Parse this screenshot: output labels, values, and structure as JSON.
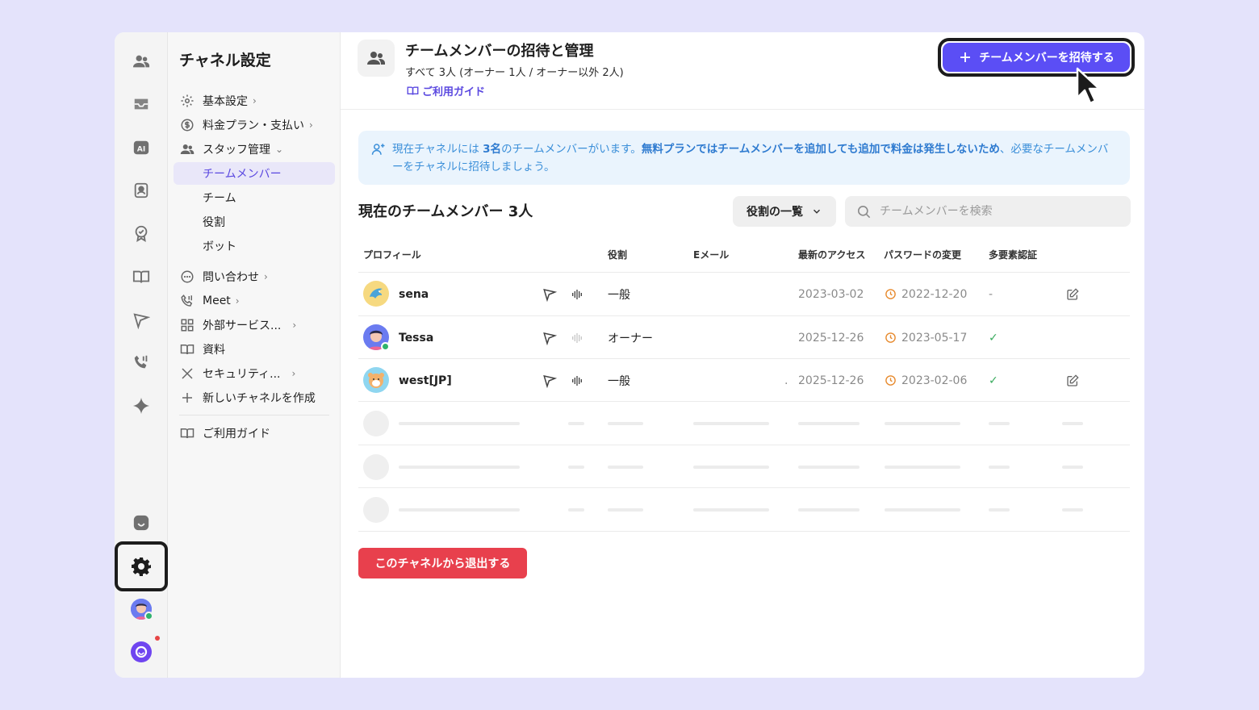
{
  "nav": {
    "title": "チャネル設定",
    "items": [
      {
        "label": "基本設定",
        "chev": "›"
      },
      {
        "label": "料金プラン・支払い",
        "chev": "›"
      },
      {
        "label": "スタッフ管理",
        "chev": "⌄"
      },
      {
        "label": "問い合わせ",
        "chev": "›"
      },
      {
        "label": "Meet",
        "chev": "›"
      },
      {
        "label": "外部サービス...",
        "chev": "›"
      },
      {
        "label": "資料",
        "chev": ""
      },
      {
        "label": "セキュリティ...",
        "chev": "›"
      },
      {
        "label": "新しいチャネルを作成",
        "chev": ""
      }
    ],
    "sub_items": [
      "チームメンバー",
      "チーム",
      "役割",
      "ボット"
    ],
    "guide": "ご利用ガイド"
  },
  "header": {
    "title": "チームメンバーの招待と管理",
    "subtitle": "すべて 3人 (オーナー 1人 / オーナー以外 2人)",
    "guide": "ご利用ガイド",
    "invite_button": "チームメンバーを招待する"
  },
  "info": {
    "part1": "現在チャネルには ",
    "bold1": "3名",
    "part2": "のチームメンバーがいます。",
    "bold2": "無料プランではチームメンバーを追加しても追加で料金は発生しないため",
    "part3": "、必要なチームメンバーをチャネルに招待しましょう。"
  },
  "section": {
    "title": "現在のチームメンバー 3人",
    "roles_button": "役割の一覧",
    "search_placeholder": "チームメンバーを検索"
  },
  "table": {
    "headers": [
      "プロフィール",
      "役割",
      "Eメール",
      "最新のアクセス",
      "パスワードの変更",
      "多要素認証"
    ],
    "rows": [
      {
        "name": "sena",
        "role": "一般",
        "email": "",
        "last_access": "2023-03-02",
        "password_changed": "2022-12-20",
        "mfa": "-"
      },
      {
        "name": "Tessa",
        "role": "オーナー",
        "email": "",
        "last_access": "2025-12-26",
        "password_changed": "2023-05-17",
        "mfa": "✓"
      },
      {
        "name": "west[JP]",
        "role": "一般",
        "email": ".",
        "last_access": "2025-12-26",
        "password_changed": "2023-02-06",
        "mfa": "✓"
      }
    ]
  },
  "leave_button": "このチャネルから退出する",
  "colors": {
    "accent": "#5b4ef5",
    "danger": "#e8404d",
    "info_text": "#3b8fd9",
    "background": "#e4e3fb"
  }
}
